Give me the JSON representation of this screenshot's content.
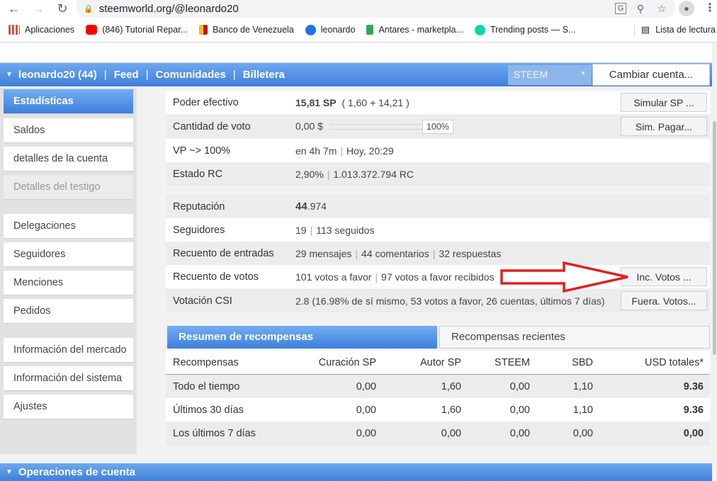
{
  "browser": {
    "url": "steemworld.org/@leonardo20",
    "bookmarks": [
      {
        "label": "Aplicaciones",
        "color": "#e04f3f"
      },
      {
        "label": "(846) Tutorial Repar...",
        "color": "#ff0000"
      },
      {
        "label": "Banco de Venezuela",
        "color": "#f4c20d"
      },
      {
        "label": "leonardo",
        "color": "#1a73e8"
      },
      {
        "label": "Antares - marketpla...",
        "color": "#34a853"
      },
      {
        "label": "Trending posts — S...",
        "color": "#07d7a9"
      }
    ],
    "reading_list": "Lista de lectura"
  },
  "header": {
    "user": "leonardo20 (44)",
    "links": [
      "Feed",
      "Comunidades",
      "Billetera"
    ],
    "currency": "STEEM",
    "switch_account": "Cambiar cuenta..."
  },
  "sidebar": {
    "items": [
      {
        "label": "Estadísticas",
        "state": "active"
      },
      {
        "label": "Saldos",
        "state": "normal"
      },
      {
        "label": "detalles de la cuenta",
        "state": "normal"
      },
      {
        "label": "Detalles del testigo",
        "state": "disabled"
      },
      {
        "label": "Delegaciones",
        "state": "normal"
      },
      {
        "label": "Seguidores",
        "state": "normal"
      },
      {
        "label": "Menciones",
        "state": "normal"
      },
      {
        "label": "Pedidos",
        "state": "normal"
      },
      {
        "label": "Información del mercado",
        "state": "normal"
      },
      {
        "label": "Información del sistema",
        "state": "normal"
      },
      {
        "label": "Ajustes",
        "state": "normal"
      }
    ]
  },
  "stats": {
    "poder_efectivo": {
      "label": "Poder efectivo",
      "value": "15,81 SP",
      "detail": "( 1,60  + 14,21 )",
      "button": "Simular SP ..."
    },
    "cantidad_voto": {
      "label": "Cantidad de voto",
      "value": "0,00 $",
      "pct": "100%",
      "button": "Sim. Pagar..."
    },
    "vp": {
      "label": "VP ~> 100%",
      "value": "en 4h 7m",
      "detail": "Hoy, 20:29"
    },
    "rc": {
      "label": "Estado RC",
      "value": "2,90%",
      "detail": "1.013.372.794 RC"
    },
    "reputacion": {
      "label": "Reputación",
      "value_main": "44",
      "value_dec": ".974"
    },
    "seguidores": {
      "label": "Seguidores",
      "value": "19",
      "detail": "113 seguidos"
    },
    "entradas": {
      "label": "Recuento de entradas",
      "v1": "29 mensajes",
      "v2": "44 comentarios",
      "v3": "32 respuestas"
    },
    "votos": {
      "label": "Recuento de votos",
      "v1": "101 votos a favor",
      "v2": "97 votos a favor recibidos",
      "button": "Inc. Votos ..."
    },
    "csi": {
      "label": "Votación CSI",
      "value": "2.8",
      "detail": "(16.98% de sí mismo, 53 votos a favor, 26 cuentas, últimos 7 días)",
      "button": "Fuera. Votos..."
    }
  },
  "rewards": {
    "tab_active": "Resumen de recompensas",
    "tab_inactive": "Recompensas recientes",
    "columns": [
      "Recompensas",
      "Curación SP",
      "Autor SP",
      "STEEM",
      "SBD",
      "USD totales"
    ],
    "columns_note": "*",
    "rows": [
      [
        "Todo el tiempo",
        "0,00",
        "1,60",
        "0,00",
        "1,10",
        "9.36"
      ],
      [
        "Últimos 30 días",
        "0,00",
        "1,60",
        "0,00",
        "1,10",
        "9.36"
      ],
      [
        "Los últimos 7 días",
        "0,00",
        "0,00",
        "0,00",
        "0,00",
        "0,00"
      ]
    ]
  },
  "footer_section": "Operaciones de cuenta",
  "colors": {
    "accent": "#3f7fd9",
    "annotation_arrow": "#e02020"
  }
}
